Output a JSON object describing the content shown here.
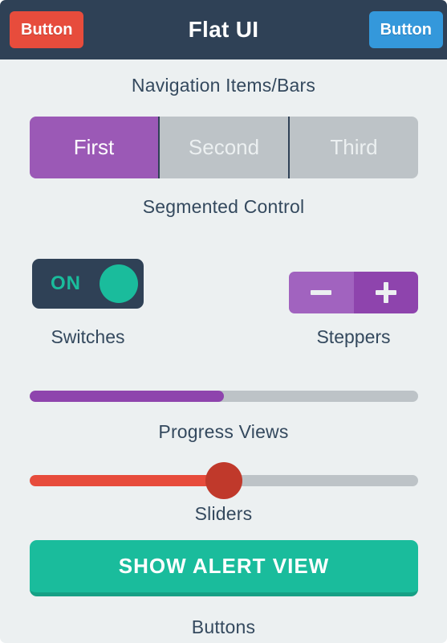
{
  "navbar": {
    "title": "Flat UI",
    "left_button": "Button",
    "right_button": "Button",
    "background_color": "#2f4156",
    "left_button_color": "#e74c3c",
    "right_button_color": "#3498db"
  },
  "captions": {
    "navigation": "Navigation Items/Bars",
    "segmented": "Segmented Control",
    "switches": "Switches",
    "steppers": "Steppers",
    "progress": "Progress Views",
    "sliders": "Sliders",
    "buttons": "Buttons"
  },
  "segmented_control": {
    "segments": [
      {
        "label": "First",
        "selected": true
      },
      {
        "label": "Second",
        "selected": false
      },
      {
        "label": "Third",
        "selected": false
      }
    ],
    "selected_color": "#9b59b6",
    "unselected_color": "#bdc3c7"
  },
  "switch": {
    "state_label": "ON",
    "is_on": true,
    "track_color": "#2f4156",
    "knob_color": "#1abc9c",
    "label_color": "#1abc9c"
  },
  "stepper": {
    "decrement_icon": "minus-icon",
    "increment_icon": "plus-icon",
    "decrement_color": "#a163bf",
    "increment_color": "#8e44ad"
  },
  "progress": {
    "value_percent": 50,
    "fill_color": "#8e44ad",
    "track_color": "#bdc3c7"
  },
  "slider": {
    "value_percent": 50,
    "fill_color": "#e74c3c",
    "track_color": "#bdc3c7",
    "knob_color": "#c0392b"
  },
  "alert_button": {
    "label": "SHOW ALERT VIEW",
    "background_color": "#1abc9c",
    "shadow_color": "#16a085"
  },
  "page": {
    "background_color": "#ecf0f1",
    "text_color": "#34495e"
  }
}
